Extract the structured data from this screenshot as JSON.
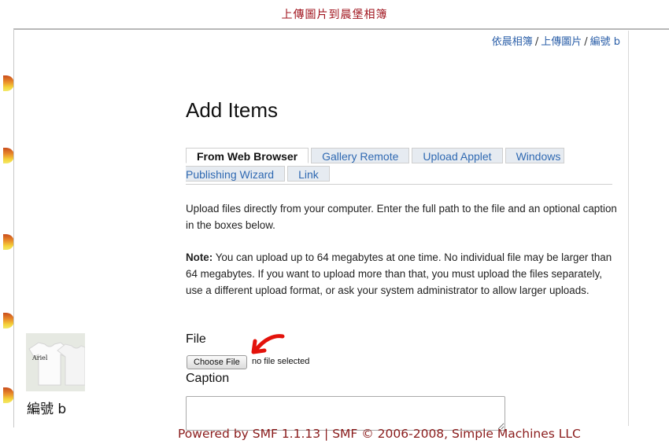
{
  "header": {
    "title": "上傳圖片到晨堡相簿"
  },
  "breadcrumb": {
    "items": [
      "依晨相簿",
      "上傳圖片",
      "編號 b"
    ],
    "separator": "/"
  },
  "page": {
    "title": "Add Items"
  },
  "tabs": [
    {
      "label": "From Web Browser",
      "active": true
    },
    {
      "label": "Gallery Remote",
      "active": false
    },
    {
      "label": "Upload Applet",
      "active": false
    },
    {
      "label": "Windows",
      "active": false
    },
    {
      "label": "Publishing Wizard",
      "active": false
    },
    {
      "label": "Link",
      "active": false
    }
  ],
  "intro": "Upload files directly from your computer. Enter the full path to the file and an optional caption in the boxes below.",
  "note": {
    "label": "Note:",
    "text": " You can upload up to 64 megabytes at one time. No individual file may be larger than 64 megabytes. If you want to upload more than that, you must upload the files separately, use a different upload format, or ask your system administrator to allow larger uploads."
  },
  "form": {
    "file_label": "File",
    "choose_file_button": "Choose File",
    "file_status": "no file selected",
    "caption_label": "Caption",
    "caption_value": ""
  },
  "album": {
    "caption": "編號 b",
    "thumb_text": "Ariel"
  },
  "footer": {
    "text": "Powered by SMF 1.1.13 | SMF © 2006-2008, Simple Machines LLC"
  },
  "colors": {
    "header_red": "#a0141e",
    "link_blue": "#2b5fa8",
    "arrow_red": "#e3120b",
    "footer_red": "#8a1b1b"
  }
}
